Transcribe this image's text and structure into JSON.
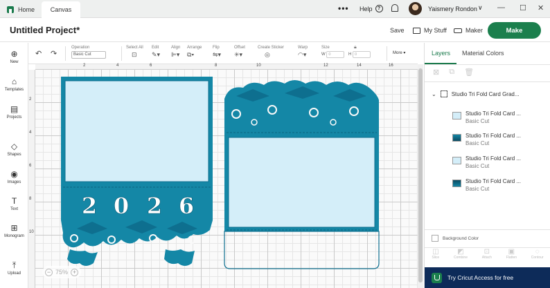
{
  "tabs": {
    "home": "Home",
    "canvas": "Canvas"
  },
  "topbar": {
    "more": "•••",
    "help": "Help",
    "help_glyph": "?",
    "username": "Yaismery Rondon",
    "chevron": "∨",
    "window_minimize": "—",
    "window_maximize": "☐",
    "window_close": "✕"
  },
  "header": {
    "project_title": "Untitled Project*",
    "save": "Save",
    "my_stuff": "My Stuff",
    "maker": "Maker",
    "make": "Make"
  },
  "leftbar": [
    {
      "label": "New",
      "icon": "plus-icon",
      "glyph": "⊕"
    },
    {
      "label": "Templates",
      "icon": "shirt-icon",
      "glyph": "⌂"
    },
    {
      "label": "Projects",
      "icon": "projects-icon",
      "glyph": "▤"
    },
    {
      "label": "Shapes",
      "icon": "shapes-icon",
      "glyph": "◇"
    },
    {
      "label": "Images",
      "icon": "lightbulb-icon",
      "glyph": "◉"
    },
    {
      "label": "Text",
      "icon": "text-icon",
      "glyph": "T"
    },
    {
      "label": "Monogram",
      "icon": "monogram-icon",
      "glyph": "⊞"
    },
    {
      "label": "Upload",
      "icon": "upload-icon",
      "glyph": "⤒"
    }
  ],
  "toolbar": {
    "undo": "↶",
    "redo": "↷",
    "operation_label": "Operation",
    "operation_value": "Basic Cut",
    "select_all": "Select All",
    "edit": "Edit",
    "align": "Align",
    "arrange": "Arrange",
    "flip": "Flip",
    "offset": "Offset",
    "create_sticker": "Create Sticker",
    "warp": "Warp",
    "size": "Size",
    "w_label": "W",
    "w_value": "0",
    "h_label": "H",
    "h_value": "0",
    "more": "More ▾"
  },
  "ruler": {
    "top": [
      "2",
      "4",
      "6",
      "8",
      "10",
      "12",
      "14",
      "16"
    ],
    "left": [
      "2",
      "4",
      "6",
      "8",
      "10"
    ]
  },
  "canvas": {
    "year_digits": [
      "2",
      "0",
      "2",
      "6"
    ],
    "zoom": "75%",
    "zoom_out": "−",
    "zoom_in": "+"
  },
  "rightpanel": {
    "tab_layers": "Layers",
    "tab_colors": "Material Colors",
    "group_name": "Studio Tri Fold Card Grad...",
    "layers": [
      {
        "name": "Studio Tri Fold Card ...",
        "sub": "Basic Cut",
        "color": "#d4eef9"
      },
      {
        "name": "Studio Tri Fold Card ...",
        "sub": "Basic Cut",
        "color": "#0e6f8f"
      },
      {
        "name": "Studio Tri Fold Card ...",
        "sub": "Basic Cut",
        "color": "#d4eef9"
      },
      {
        "name": "Studio Tri Fold Card ...",
        "sub": "Basic Cut",
        "color": "#0e6f8f"
      }
    ],
    "background_color": "Background Color",
    "actions": [
      "Slice",
      "Combine",
      "Attach",
      "Flatten",
      "Contour"
    ],
    "access": "Try Cricut Access for free"
  },
  "colors": {
    "accent": "#1b7f4d",
    "card_teal": "#1487a6",
    "card_light": "#d4eef9",
    "access_bg": "#0d2b59"
  }
}
